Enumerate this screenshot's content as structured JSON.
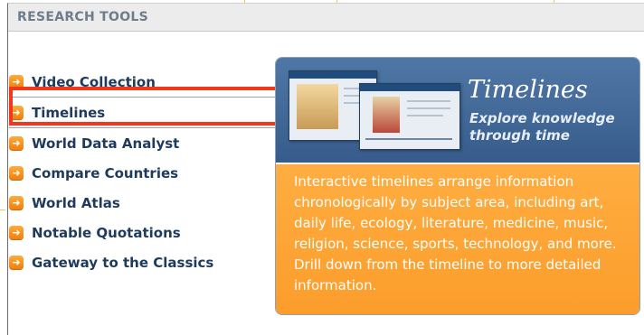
{
  "panel": {
    "title": "RESEARCH TOOLS"
  },
  "nav": {
    "items": [
      {
        "label": "Video Collection",
        "icon": "arrow-right-icon",
        "selected": false
      },
      {
        "label": "Timelines",
        "icon": "arrow-right-icon",
        "selected": true
      },
      {
        "label": "World Data Analyst",
        "icon": "arrow-right-icon",
        "selected": false
      },
      {
        "label": "Compare Countries",
        "icon": "arrow-right-icon",
        "selected": false
      },
      {
        "label": "World Atlas",
        "icon": "arrow-right-icon",
        "selected": false
      },
      {
        "label": "Notable Quotations",
        "icon": "arrow-right-icon",
        "selected": false
      },
      {
        "label": "Gateway to the Classics",
        "icon": "arrow-right-icon",
        "selected": false
      }
    ]
  },
  "feature": {
    "title": "Timelines",
    "subtitle": "Explore knowledge through time",
    "description": "Interactive timelines arrange information chronologically by subject area, including art, daily life, ecology, literature, medicine, music, religion, science, sports, technology, and more. Drill down from the timeline to more detailed information."
  },
  "colors": {
    "accent_orange": "#fb9d2b",
    "header_blue": "#375c8c",
    "nav_text": "#1e3a5c",
    "highlight_red": "#f4361c"
  }
}
